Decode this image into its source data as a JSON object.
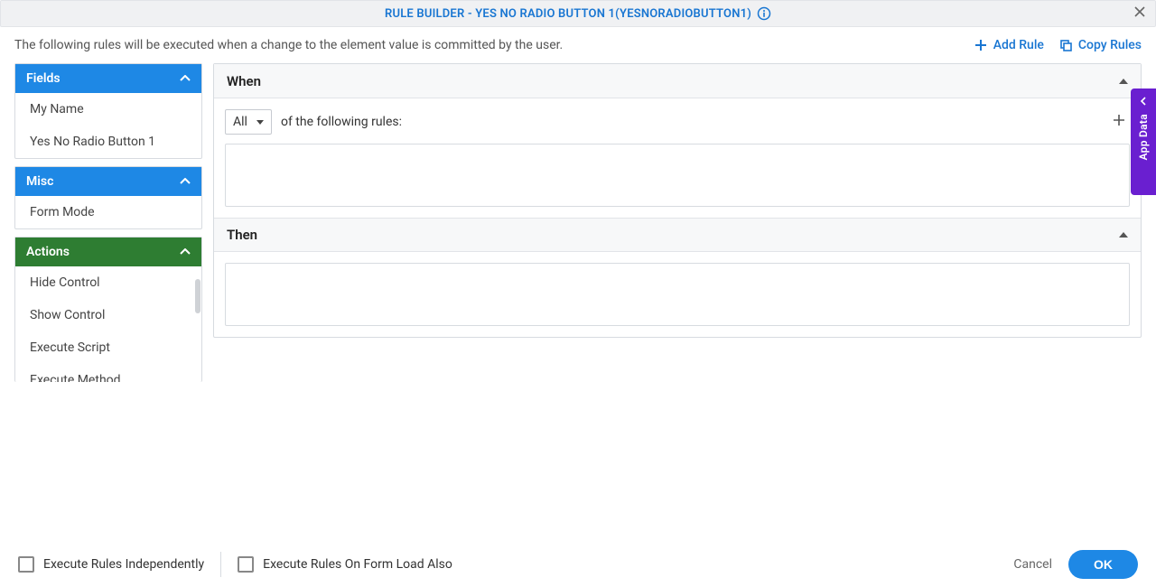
{
  "titlebar": {
    "title": "RULE BUILDER - YES NO RADIO BUTTON 1(YESNORADIOBUTTON1)"
  },
  "toolbar": {
    "description": "The following rules will be executed when a change to the element value is committed by the user.",
    "add_rule": "Add Rule",
    "copy_rules": "Copy Rules"
  },
  "sidebar": {
    "fields": {
      "header": "Fields",
      "items": [
        "My Name",
        "Yes No Radio Button 1"
      ]
    },
    "misc": {
      "header": "Misc",
      "items": [
        "Form Mode"
      ]
    },
    "actions": {
      "header": "Actions",
      "items": [
        "Hide Control",
        "Show Control",
        "Execute Script",
        "Execute Method"
      ]
    }
  },
  "main": {
    "when": {
      "title": "When",
      "match_selector": "All",
      "match_label": "of the following rules:"
    },
    "then": {
      "title": "Then"
    }
  },
  "side_tab": "App Data",
  "footer": {
    "chk1": "Execute Rules Independently",
    "chk2": "Execute Rules On Form Load Also",
    "cancel": "Cancel",
    "ok": "OK"
  }
}
